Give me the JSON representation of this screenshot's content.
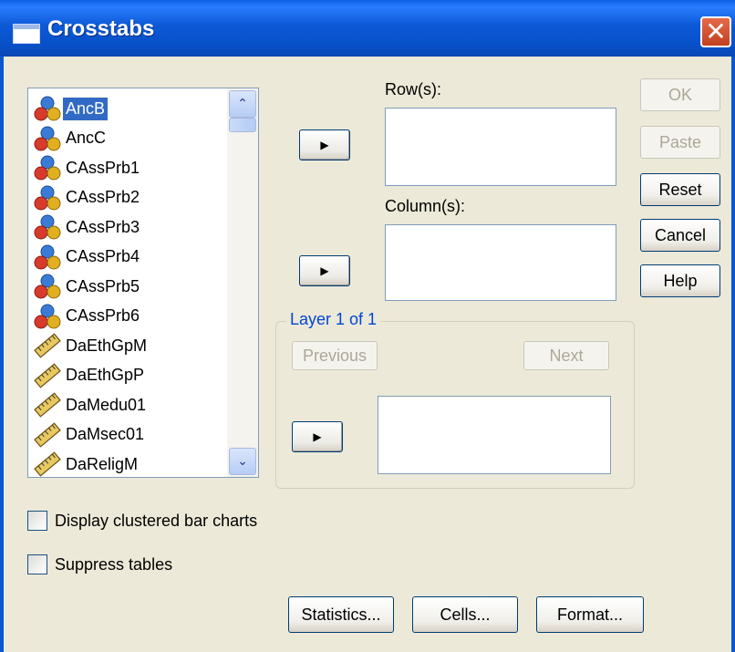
{
  "window": {
    "title": "Crosstabs",
    "close_glyph": "✕"
  },
  "variables": [
    {
      "label": "AncB",
      "icon": "nominal-icon",
      "selected": true
    },
    {
      "label": "AncC",
      "icon": "nominal-icon"
    },
    {
      "label": "CAssPrb1",
      "icon": "nominal-icon"
    },
    {
      "label": "CAssPrb2",
      "icon": "nominal-icon"
    },
    {
      "label": "CAssPrb3",
      "icon": "nominal-icon"
    },
    {
      "label": "CAssPrb4",
      "icon": "nominal-icon"
    },
    {
      "label": "CAssPrb5",
      "icon": "nominal-icon"
    },
    {
      "label": "CAssPrb6",
      "icon": "nominal-icon"
    },
    {
      "label": "DaEthGpM",
      "icon": "scale-ruler-icon"
    },
    {
      "label": "DaEthGpP",
      "icon": "scale-ruler-icon"
    },
    {
      "label": "DaMedu01",
      "icon": "scale-ruler-icon"
    },
    {
      "label": "DaMsec01",
      "icon": "scale-ruler-icon"
    },
    {
      "label": "DaReligM",
      "icon": "scale-ruler-icon"
    }
  ],
  "scrollbar": {
    "up_glyph": "⌃",
    "down_glyph": "⌄"
  },
  "move_arrow_glyph": "▶",
  "rows_label": "Row(s):",
  "columns_label": "Column(s):",
  "layer": {
    "legend": "Layer 1 of 1",
    "previous": "Previous",
    "next": "Next"
  },
  "side_buttons": {
    "ok": "OK",
    "paste": "Paste",
    "reset": "Reset",
    "cancel": "Cancel",
    "help": "Help"
  },
  "checkboxes": {
    "clustered_bar": {
      "label": "Display clustered bar charts",
      "checked": false
    },
    "suppress": {
      "label": "Suppress tables",
      "checked": false
    }
  },
  "bottom_buttons": {
    "statistics": "Statistics...",
    "cells": "Cells...",
    "format": "Format..."
  },
  "colors": {
    "title_bar": "#0a5fe3",
    "dialog_bg": "#ece9d8",
    "selection": "#316ac5",
    "layer_legend": "#0046d5"
  }
}
